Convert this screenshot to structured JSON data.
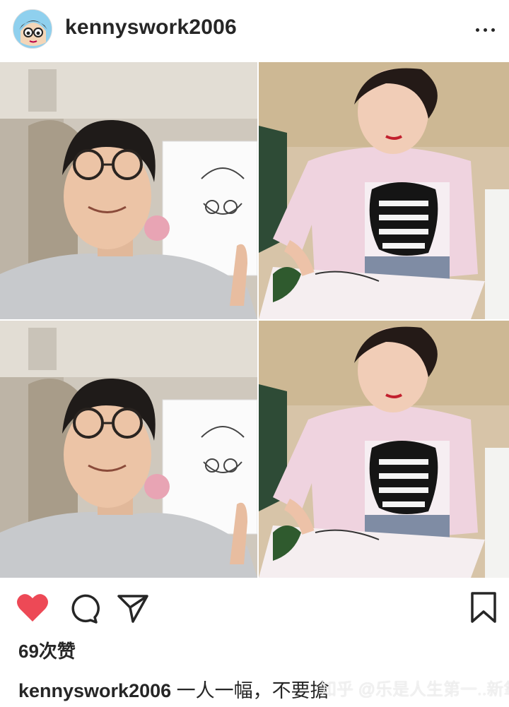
{
  "post": {
    "username": "kennyswork2006",
    "more_icon": "more-dots-icon"
  },
  "actions": {
    "like_icon": "heart-icon",
    "like_color": "#ed4956",
    "comment_icon": "comment-icon",
    "share_icon": "send-icon",
    "save_icon": "bookmark-icon"
  },
  "likes_text": "69次赞",
  "caption": {
    "username": "kennyswork2006",
    "text": " 一人一幅，不要搶"
  },
  "watermark": "知乎 @乐是人生第一..新氧"
}
